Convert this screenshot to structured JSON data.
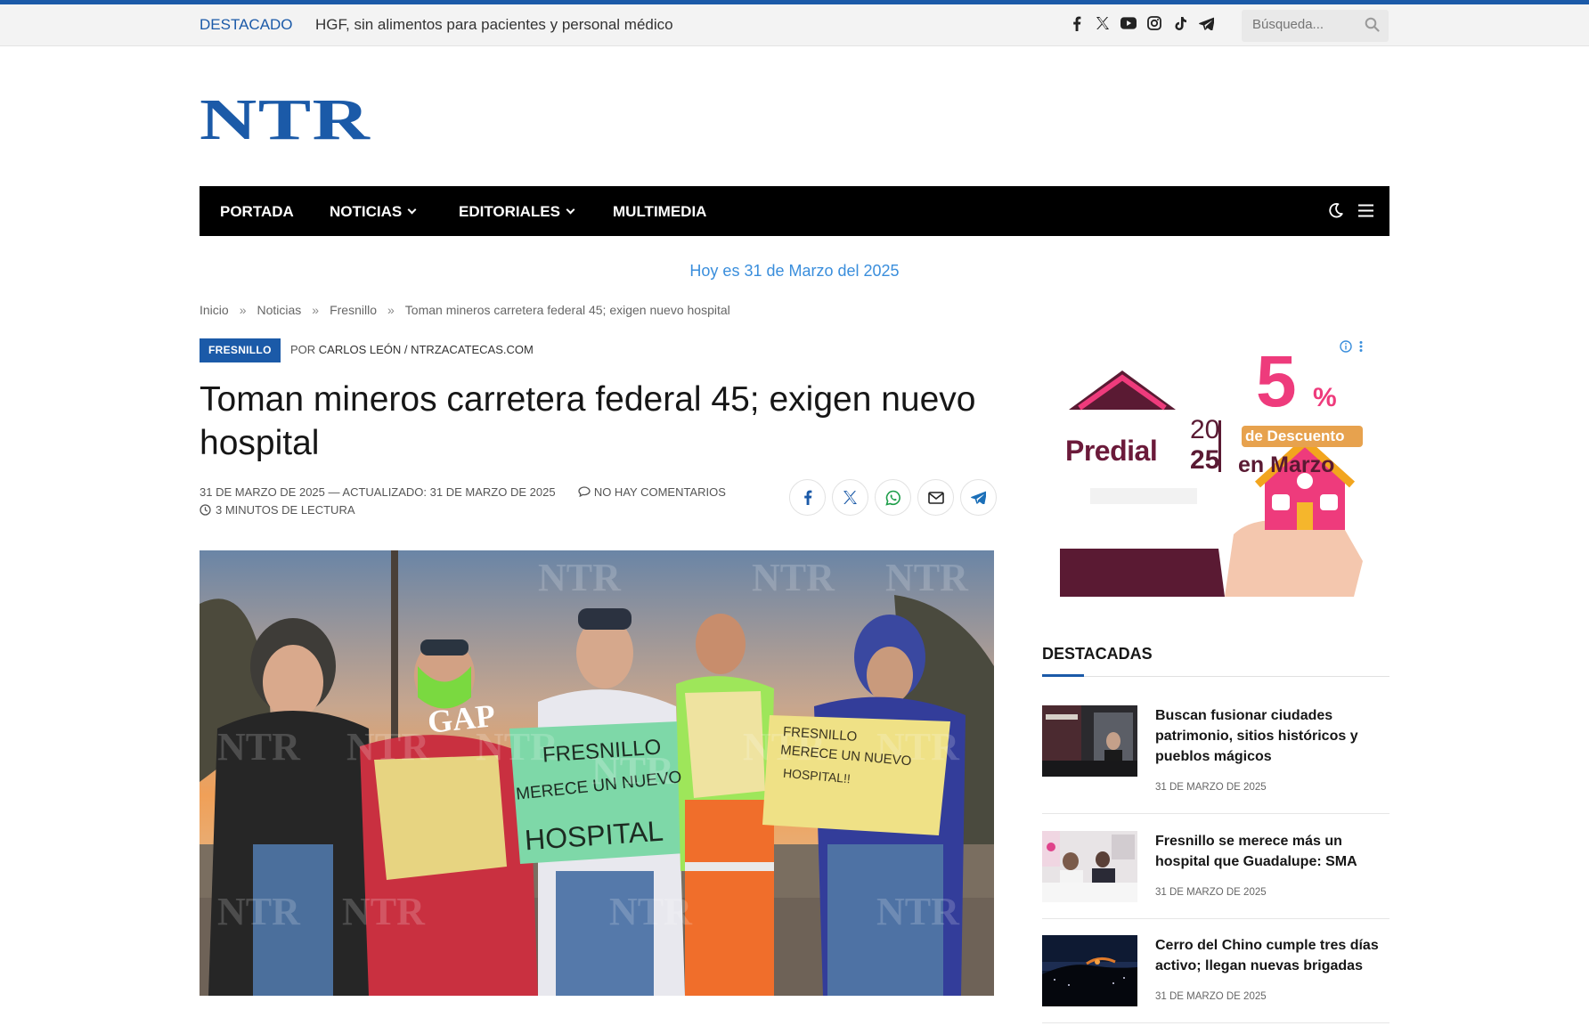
{
  "topbar": {
    "trending_label": "DESTACADO",
    "trending_text": "HGF, sin alimentos para pacientes y personal médico",
    "search_placeholder": "Búsqueda...",
    "socials": [
      "facebook-icon",
      "x-icon",
      "youtube-icon",
      "instagram-icon",
      "tiktok-icon",
      "telegram-icon"
    ]
  },
  "brand": {
    "logo": "NTR",
    "color": "#1b5aa8"
  },
  "nav": {
    "items": [
      {
        "label": "PORTADA",
        "dropdown": false
      },
      {
        "label": "NOTICIAS",
        "dropdown": true
      },
      {
        "label": "EDITORIALES",
        "dropdown": true
      },
      {
        "label": "MULTIMEDIA",
        "dropdown": false
      }
    ]
  },
  "date_line": "Hoy es 31 de Marzo del 2025",
  "breadcrumb": {
    "items": [
      "Inicio",
      "Noticias",
      "Fresnillo",
      "Toman mineros carretera federal 45; exigen nuevo hospital"
    ],
    "separator": "»"
  },
  "article": {
    "category": "FRESNILLO",
    "by_prefix": "POR",
    "author": "CARLOS LEÓN / NTRZACATECAS.COM",
    "title": "Toman mineros carretera federal 45; exigen nuevo hospital",
    "published": "31 DE MARZO DE 2025",
    "updated_label": "— ACTUALIZADO:",
    "updated": "31 DE MARZO DE 2025",
    "comments": "NO HAY COMENTARIOS",
    "reading_time": "3 MINUTOS DE LECTURA",
    "share": [
      "facebook-icon",
      "x-icon",
      "whatsapp-icon",
      "email-icon",
      "telegram-icon"
    ],
    "photo": {
      "watermark": "NTR",
      "signs": [
        "FRESNILLO",
        "MERECE UN NUEVO",
        "HOSPITAL",
        "FRESNILLO",
        "MERECE UN NUEVO",
        "HOSPITAL!!"
      ],
      "cap_text": "GAP"
    }
  },
  "ad": {
    "brand": "Predial",
    "year_top": "20",
    "year_bottom": "25",
    "percent": "5",
    "percent_sign": "%",
    "descuento": "de Descuento",
    "month": "en Marzo"
  },
  "sidebar": {
    "title": "DESTACADAS",
    "stories": [
      {
        "title": "Buscan fusionar ciudades patrimonio, sitios históricos y pueblos mágicos",
        "date": "31 DE MARZO DE 2025"
      },
      {
        "title": "Fresnillo se merece más un hospital que Guadalupe: SMA",
        "date": "31 DE MARZO DE 2025"
      },
      {
        "title": "Cerro del Chino cumple tres días activo; llegan nuevas brigadas",
        "date": "31 DE MARZO DE 2025"
      }
    ]
  }
}
